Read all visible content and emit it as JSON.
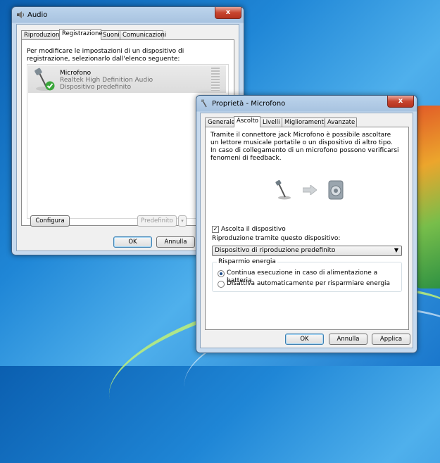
{
  "audio_window": {
    "title": "Audio",
    "close": "x",
    "tabs": [
      "Riproduzione",
      "Registrazione",
      "Suoni",
      "Comunicazioni"
    ],
    "active_tab": "Registrazione",
    "instruction": "Per modificare le impostazioni di un dispositivo di registrazione, selezionarlo dall'elenco seguente:",
    "device": {
      "name": "Microfono",
      "driver": "Realtek High Definition Audio",
      "status": "Dispositivo predefinito"
    },
    "configure_button": "Configura",
    "default_button": "Predefinito",
    "ok_button": "OK",
    "cancel_button": "Annulla"
  },
  "props_window": {
    "title": "Proprietà - Microfono",
    "close": "x",
    "tabs": [
      "Generale",
      "Ascolto",
      "Livelli",
      "Miglioramenti",
      "Avanzate"
    ],
    "active_tab": "Ascolto",
    "description": "Tramite il connettore jack Microfono è possibile ascoltare un lettore musicale portatile o un dispositivo di altro tipo. In caso di collegamento di un microfono possono verificarsi fenomeni di feedback.",
    "listen_checkbox": "Ascolta il dispositivo",
    "listen_checked": true,
    "playback_label": "Riproduzione tramite questo dispositivo:",
    "playback_selected": "Dispositivo di riproduzione predefinito",
    "power_group_title": "Risparmio energia",
    "power_options": [
      "Continua esecuzione in caso di alimentazione a batteria",
      "Disattiva automaticamente per risparmiare energia"
    ],
    "power_selected_index": 0,
    "ok_button": "OK",
    "cancel_button": "Annulla",
    "apply_button": "Applica"
  }
}
